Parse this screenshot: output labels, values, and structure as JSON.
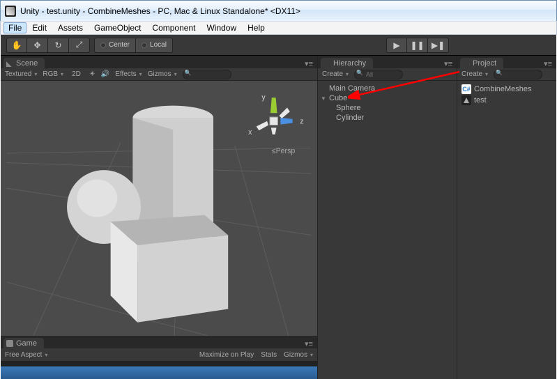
{
  "window": {
    "title": "Unity - test.unity - CombineMeshes - PC, Mac & Linux Standalone* <DX11>"
  },
  "menu": {
    "items": [
      "File",
      "Edit",
      "Assets",
      "GameObject",
      "Component",
      "Window",
      "Help"
    ]
  },
  "toolbar": {
    "center": "Center",
    "local": "Local"
  },
  "scene": {
    "tab": "Scene",
    "shading": "Textured",
    "render": "RGB",
    "twoD": "2D",
    "effects": "Effects",
    "gizmos": "Gizmos",
    "persp": "Persp",
    "axis_x": "x",
    "axis_y": "y",
    "axis_z": "z"
  },
  "game": {
    "tab": "Game",
    "aspect": "Free Aspect",
    "maximize": "Maximize on Play",
    "stats": "Stats",
    "gizmos": "Gizmos"
  },
  "hierarchy": {
    "tab": "Hierarchy",
    "create": "Create",
    "search_placeholder": "All",
    "items": [
      "Main Camera",
      "Cube",
      "Sphere",
      "Cylinder"
    ]
  },
  "project": {
    "tab": "Project",
    "create": "Create",
    "items": [
      {
        "name": "CombineMeshes",
        "icon": "cs"
      },
      {
        "name": "test",
        "icon": "unity"
      }
    ]
  }
}
